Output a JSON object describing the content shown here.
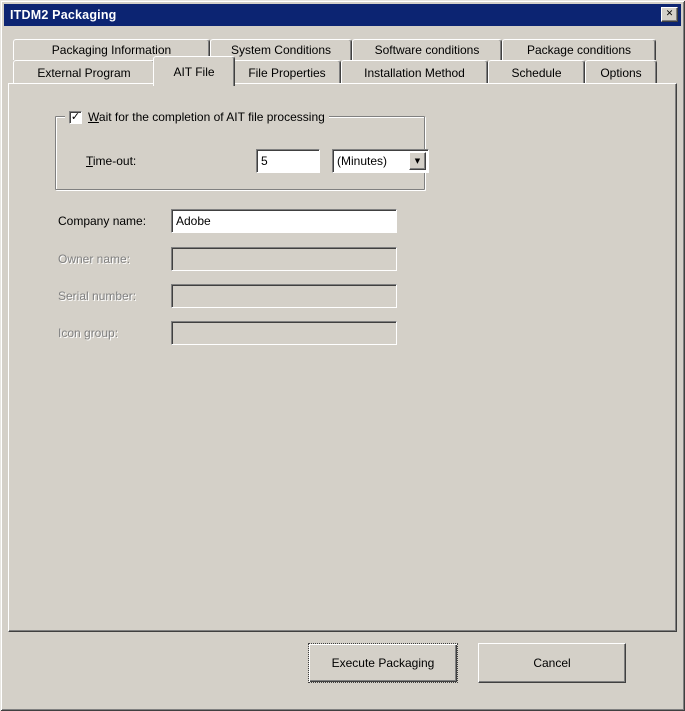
{
  "window": {
    "title": "ITDM2 Packaging",
    "close_glyph": "✕"
  },
  "tabs": {
    "row1": [
      {
        "label": "Packaging Information"
      },
      {
        "label": "System Conditions"
      },
      {
        "label": "Software conditions"
      },
      {
        "label": "Package conditions"
      }
    ],
    "row2": [
      {
        "label": "External Program"
      },
      {
        "label": "AIT File",
        "active": true
      },
      {
        "label": "File Properties"
      },
      {
        "label": "Installation Method"
      },
      {
        "label": "Schedule"
      },
      {
        "label": "Options"
      }
    ]
  },
  "wait_group": {
    "checkbox": {
      "checked": true,
      "glyph": "✓",
      "label_accel": "W",
      "label_rest": "ait for the completion of AIT file processing"
    },
    "timeout": {
      "label_accel": "T",
      "label_rest": "ime-out:",
      "value": "5",
      "unit": "(Minutes)",
      "dropdown_glyph": "▼"
    }
  },
  "fields": [
    {
      "label": "Company name:",
      "value": "Adobe",
      "enabled": true
    },
    {
      "label": "Owner name:",
      "value": "",
      "enabled": false
    },
    {
      "label": "Serial number:",
      "value": "",
      "enabled": false
    },
    {
      "label": "Icon group:",
      "value": "",
      "enabled": false
    }
  ],
  "actions": {
    "execute": "Execute Packaging",
    "cancel": "Cancel"
  },
  "colors": {
    "titlebar": "#0c2472",
    "face": "#d4d0c8",
    "field_bg": "#ffffff",
    "disabled_text": "#808080"
  }
}
